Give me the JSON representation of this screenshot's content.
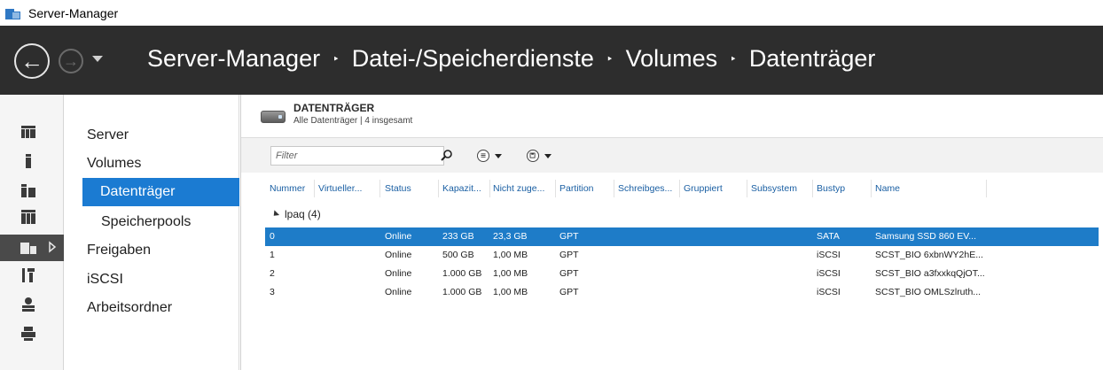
{
  "window": {
    "title": "Server-Manager"
  },
  "breadcrumb": [
    "Server-Manager",
    "Datei-/Speicherdienste",
    "Volumes",
    "Datenträger"
  ],
  "breadcrumb_separator": "‣",
  "nav": {
    "items": [
      {
        "label": "Server"
      },
      {
        "label": "Volumes"
      },
      {
        "label": "Datenträger"
      },
      {
        "label": "Speicherpools"
      },
      {
        "label": "Freigaben"
      },
      {
        "label": "iSCSI"
      },
      {
        "label": "Arbeitsordner"
      }
    ],
    "selected": "Datenträger"
  },
  "rail_icons": [
    "dashboard-icon",
    "local-server-icon",
    "all-servers-icon",
    "server-group-icon",
    "file-storage-icon",
    "tools-icon",
    "network-icon",
    "print-icon"
  ],
  "panel": {
    "title": "DATENTRÄGER",
    "subtitle": "Alle Datenträger | 4 insgesamt"
  },
  "filter": {
    "placeholder": "Filter"
  },
  "table": {
    "columns": [
      "Nummer",
      "Virtueller...",
      "Status",
      "Kapazit...",
      "Nicht zuge...",
      "Partition",
      "Schreibges...",
      "Gruppiert",
      "Subsystem",
      "Bustyp",
      "Name"
    ],
    "group_label": "lpaq (4)",
    "rows": [
      {
        "nummer": "0",
        "virtuell": "",
        "status": "Online",
        "kapazitaet": "233 GB",
        "nicht_zugeordnet": "23,3 GB",
        "partition": "GPT",
        "schreibgeschuetzt": "",
        "gruppiert": "",
        "subsystem": "",
        "bustyp": "SATA",
        "name": "Samsung SSD 860 EV...",
        "selected": true
      },
      {
        "nummer": "1",
        "virtuell": "",
        "status": "Online",
        "kapazitaet": "500 GB",
        "nicht_zugeordnet": "1,00 MB",
        "partition": "GPT",
        "schreibgeschuetzt": "",
        "gruppiert": "",
        "subsystem": "",
        "bustyp": "iSCSI",
        "name": "SCST_BIO 6xbnWY2hE...",
        "selected": false
      },
      {
        "nummer": "2",
        "virtuell": "",
        "status": "Online",
        "kapazitaet": "1.000 GB",
        "nicht_zugeordnet": "1,00 MB",
        "partition": "GPT",
        "schreibgeschuetzt": "",
        "gruppiert": "",
        "subsystem": "",
        "bustyp": "iSCSI",
        "name": "SCST_BIO a3fxxkqQjOT...",
        "selected": false
      },
      {
        "nummer": "3",
        "virtuell": "",
        "status": "Online",
        "kapazitaet": "1.000 GB",
        "nicht_zugeordnet": "1,00 MB",
        "partition": "GPT",
        "schreibgeschuetzt": "",
        "gruppiert": "",
        "subsystem": "",
        "bustyp": "iSCSI",
        "name": "SCST_BIO OMLSzlruth...",
        "selected": false
      }
    ]
  },
  "colors": {
    "header_bg": "#2d2d2d",
    "selection": "#1e7cc8",
    "link_blue": "#1a5fa3"
  }
}
